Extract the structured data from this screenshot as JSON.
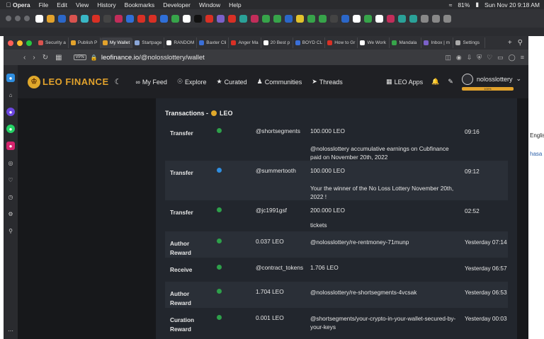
{
  "menubar": {
    "app": "Opera",
    "items": [
      "File",
      "Edit",
      "View",
      "History",
      "Bookmarks",
      "Developer",
      "Window",
      "Help"
    ],
    "battery": "81%",
    "datetime": "Sun Nov 20  9:18 AM"
  },
  "window": {
    "tabs": [
      {
        "label": "Security a",
        "color": "#d9534f"
      },
      {
        "label": "Publish P",
        "color": "#e2a22c"
      },
      {
        "label": "My Wallet",
        "color": "#e2a22c",
        "active": true
      },
      {
        "label": "Startpage",
        "color": "#8aa6d8"
      },
      {
        "label": "RANDOM",
        "color": "#ffffff"
      },
      {
        "label": "Baxter Cli",
        "color": "#3a6fd8"
      },
      {
        "label": "Anger Ma",
        "color": "#d93025"
      },
      {
        "label": "20 Best p",
        "color": "#ffffff"
      },
      {
        "label": "BOYD CL",
        "color": "#3a6fd8"
      },
      {
        "label": "How to Gr",
        "color": "#d93025"
      },
      {
        "label": "We Work",
        "color": "#ffffff"
      },
      {
        "label": "Mandala",
        "color": "#37a44a"
      },
      {
        "label": "Inbox | m",
        "color": "#7b61c9"
      },
      {
        "label": "Settings",
        "color": "#aaaaaa"
      }
    ],
    "address": {
      "vpn": "VPN",
      "domain": "leofinance.io",
      "path": "/@nolosslottery/wallet"
    }
  },
  "leo": {
    "brand": "LEO FINANCE",
    "nav": [
      "My Feed",
      "Explore",
      "Curated",
      "Communities",
      "Threads"
    ],
    "apps_label": "LEO Apps",
    "username": "nolosslottery",
    "rc_label": "100%",
    "rc_fraction": 1.0
  },
  "transactions": {
    "title": "Transactions -",
    "token": "LEO",
    "rows": [
      {
        "type": "Transfer",
        "status": "in",
        "account": "@shortsegments",
        "amount": "100.000 LEO",
        "memo": "@nolosslottery accumulative earnings on Cubfinance paid on November 20th, 2022",
        "time": "09:16",
        "alt": false
      },
      {
        "type": "Transfer",
        "status": "out",
        "account": "@summertooth",
        "amount": "100.000 LEO",
        "memo": "Your the winner of the No Loss Lottery November 20th, 2022 !",
        "time": "09:12",
        "alt": true
      },
      {
        "type": "Transfer",
        "status": "in",
        "account": "@jc1991gsf",
        "amount": "200.000 LEO",
        "memo": "tickets",
        "time": "02:52",
        "alt": false
      },
      {
        "type": "Author Reward",
        "status": "in",
        "amount_left": "0.037 LEO",
        "memo": "@nolosslottery/re-rentmoney-71munp",
        "time": "Yesterday 07:14",
        "alt": true
      },
      {
        "type": "Receive",
        "status": "in",
        "account": "@contract_tokens",
        "amount": "1.706 LEO",
        "time": "Yesterday 06:57",
        "alt": false
      },
      {
        "type": "Author Reward",
        "status": "in",
        "amount_left": "1.704 LEO",
        "memo": "@nolosslottery/re-shortsegments-4vcsak",
        "time": "Yesterday 06:53",
        "alt": true
      },
      {
        "type": "Curation Reward",
        "status": "in",
        "amount_left": "0.001 LEO",
        "memo": "@shortsegments/your-crypto-in-your-wallet-secured-by-your-keys",
        "time": "Yesterday 00:03",
        "alt": false
      }
    ]
  },
  "peek": {
    "line1": "Englis",
    "line2": "hasa"
  },
  "colors": {
    "accent": "#e2a22c",
    "green": "#2ea04a",
    "blue": "#2f8ee0"
  }
}
